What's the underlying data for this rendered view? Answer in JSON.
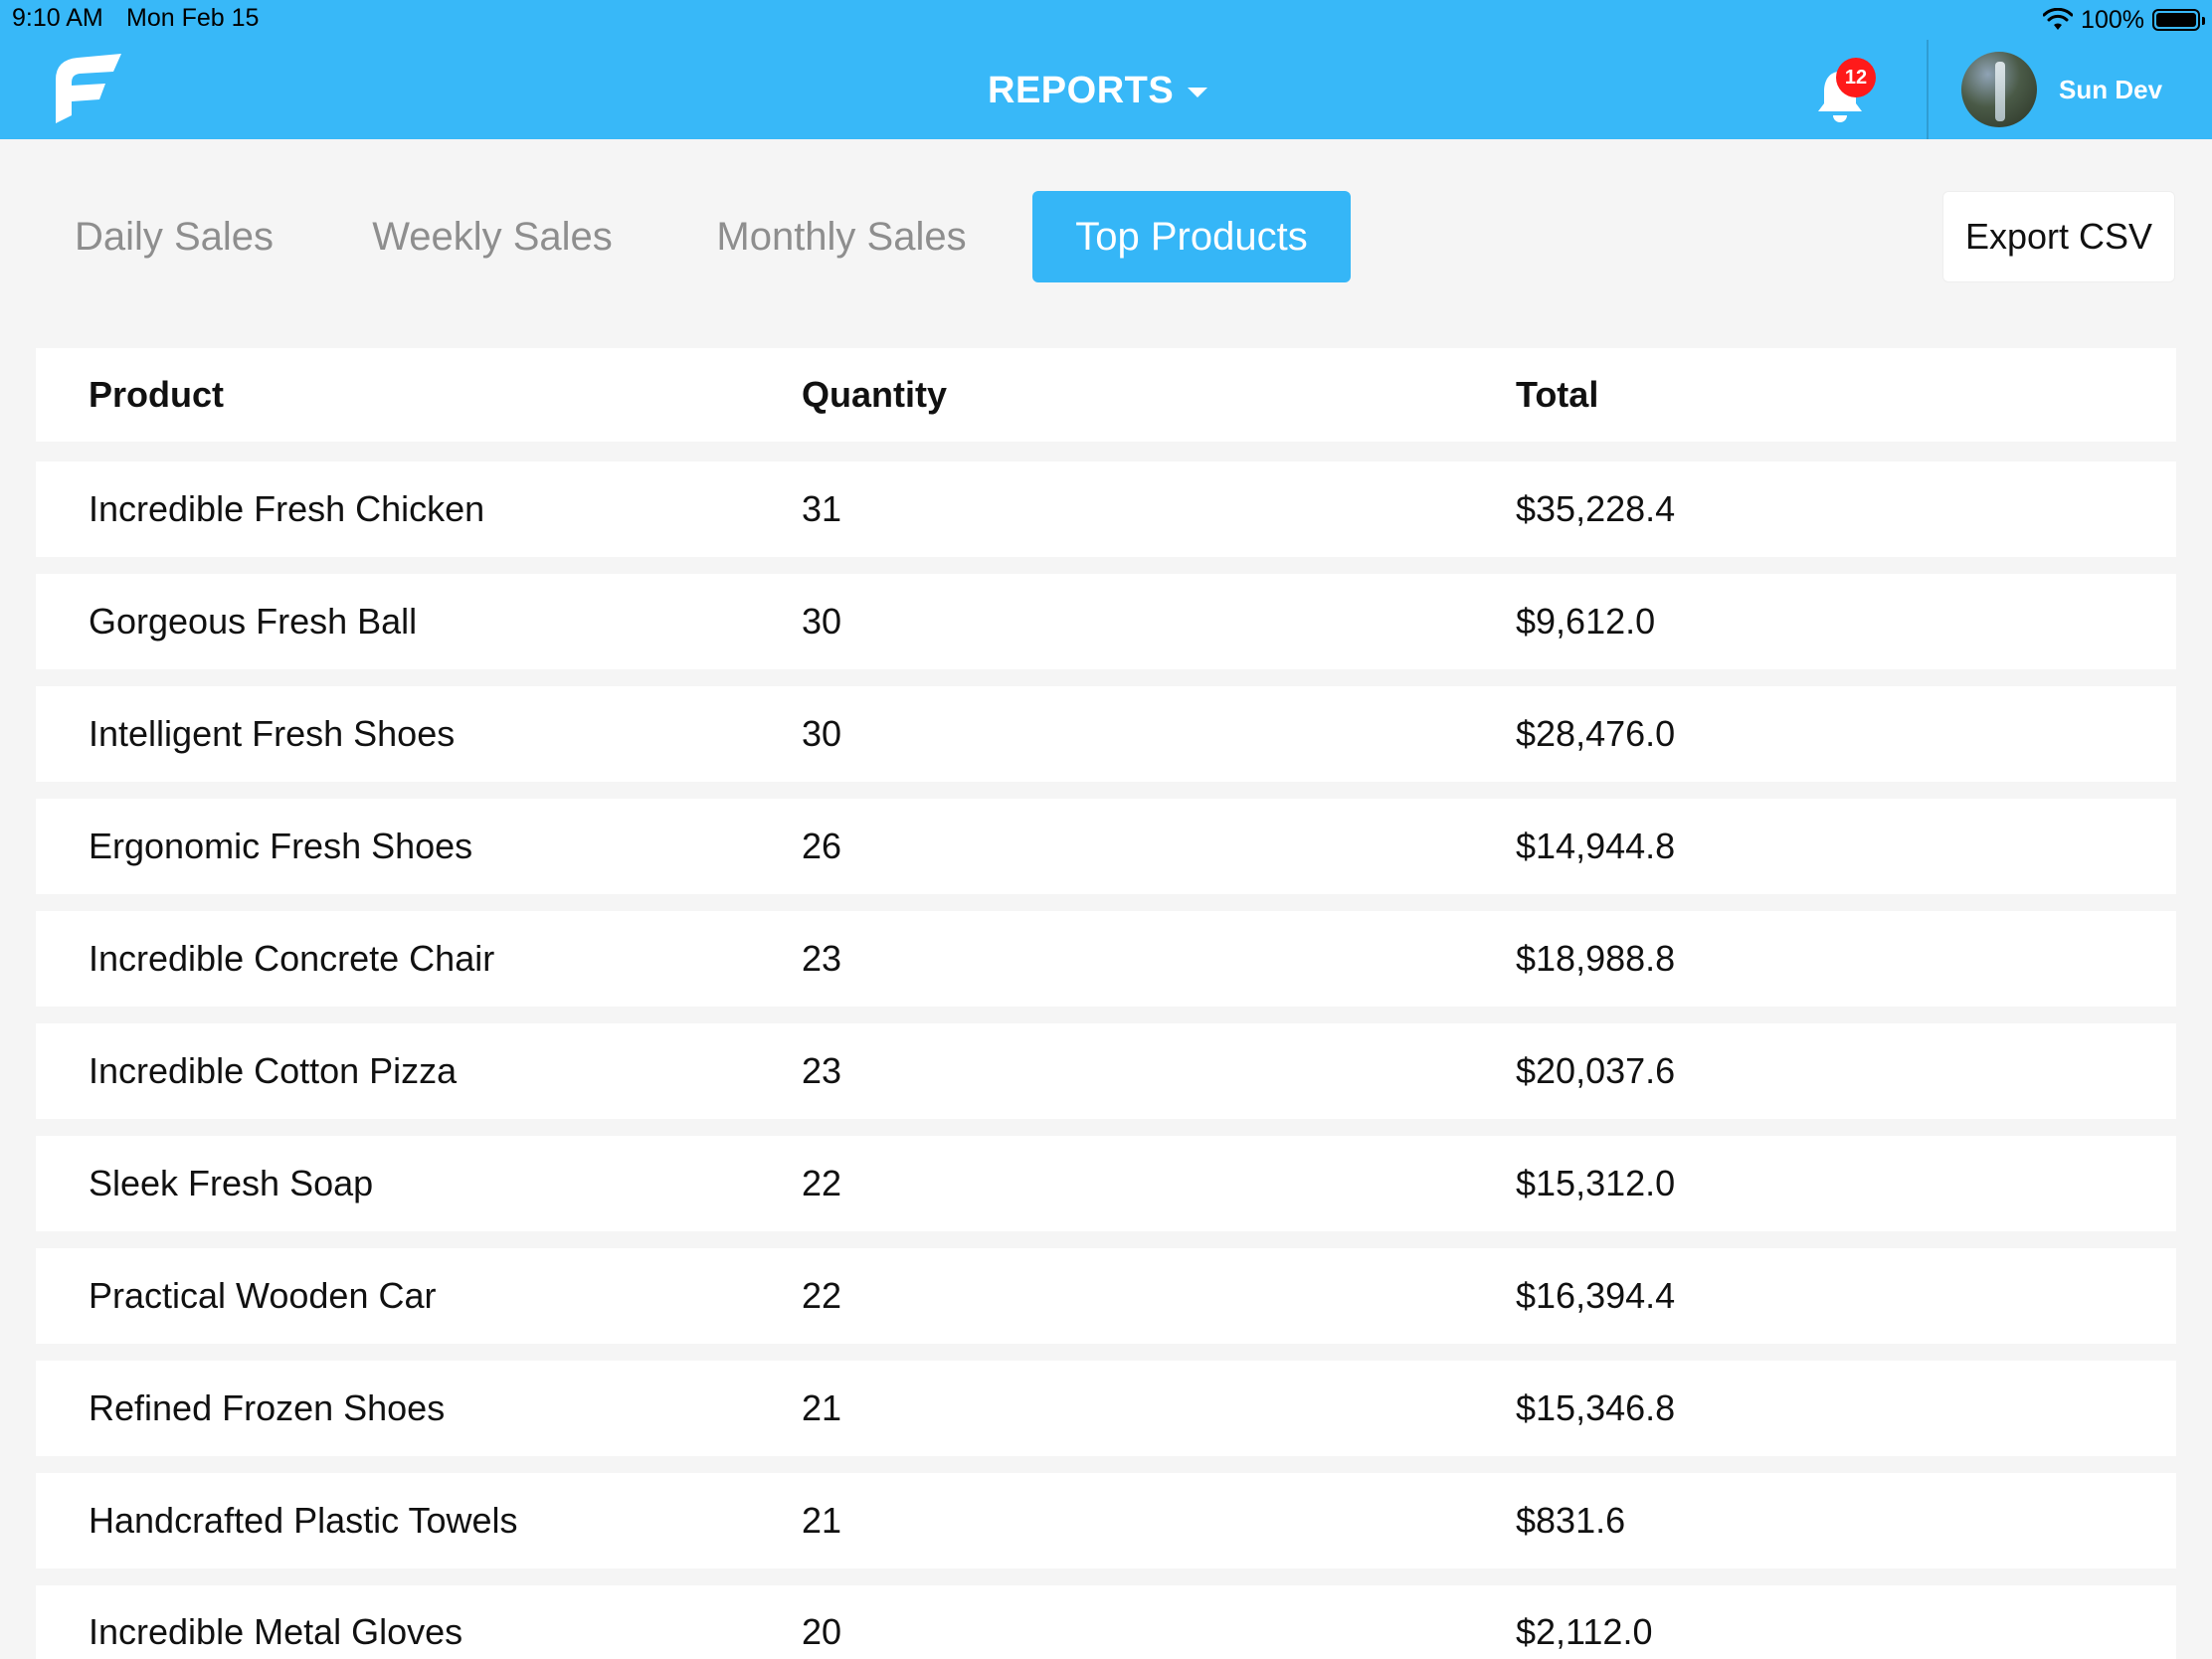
{
  "status_bar": {
    "time": "9:10 AM",
    "date": "Mon Feb 15",
    "battery": "100%"
  },
  "header": {
    "title": "REPORTS",
    "notification_count": "12",
    "user_name": "Sun Dev",
    "brand_color": "#38b8f8"
  },
  "tabs": [
    {
      "label": "Daily Sales",
      "active": false
    },
    {
      "label": "Weekly Sales",
      "active": false
    },
    {
      "label": "Monthly Sales",
      "active": false
    },
    {
      "label": "Top Products",
      "active": true
    }
  ],
  "toolbar": {
    "export_label": "Export CSV"
  },
  "table": {
    "columns": [
      "Product",
      "Quantity",
      "Total"
    ],
    "rows": [
      {
        "product": "Incredible Fresh Chicken",
        "quantity": "31",
        "total": "$35,228.4"
      },
      {
        "product": "Gorgeous Fresh Ball",
        "quantity": "30",
        "total": "$9,612.0"
      },
      {
        "product": "Intelligent Fresh Shoes",
        "quantity": "30",
        "total": "$28,476.0"
      },
      {
        "product": "Ergonomic Fresh Shoes",
        "quantity": "26",
        "total": "$14,944.8"
      },
      {
        "product": "Incredible Concrete Chair",
        "quantity": "23",
        "total": "$18,988.8"
      },
      {
        "product": "Incredible Cotton Pizza",
        "quantity": "23",
        "total": "$20,037.6"
      },
      {
        "product": "Sleek Fresh Soap",
        "quantity": "22",
        "total": "$15,312.0"
      },
      {
        "product": "Practical Wooden Car",
        "quantity": "22",
        "total": "$16,394.4"
      },
      {
        "product": "Refined Frozen Shoes",
        "quantity": "21",
        "total": "$15,346.8"
      },
      {
        "product": "Handcrafted Plastic Towels",
        "quantity": "21",
        "total": "$831.6"
      },
      {
        "product": "Incredible Metal Gloves",
        "quantity": "20",
        "total": "$2,112.0"
      }
    ]
  }
}
